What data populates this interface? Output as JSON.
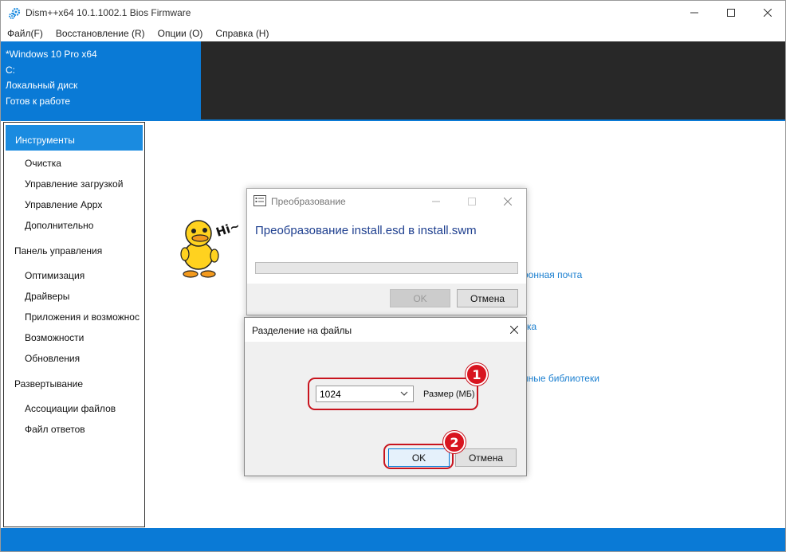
{
  "window": {
    "title": "Dism++x64 10.1.1002.1 Bios Firmware",
    "icon": "gears-icon"
  },
  "menu": [
    "Файл(F)",
    "Восстановление (R)",
    "Опции (O)",
    "Справка (H)"
  ],
  "header": {
    "lines": [
      "*Windows 10 Pro x64",
      "C:",
      "Локальный диск",
      "Готов к работе"
    ]
  },
  "sidebar": {
    "active": "Инструменты",
    "groups": [
      {
        "category": null,
        "items": [
          "Очистка",
          "Управление загрузкой",
          "Управление Appx",
          "Дополнительно"
        ]
      },
      {
        "category": "Панель управления",
        "items": [
          "Оптимизация",
          "Драйверы",
          "Приложения и возможнос",
          "Возможности",
          "Обновления"
        ]
      },
      {
        "category": "Развертывание",
        "items": [
          "Ассоциации файлов",
          "Файл ответов"
        ]
      }
    ]
  },
  "background_links": [
    "ронная почта",
    "ка",
    "нные библиотеки"
  ],
  "convert_dialog": {
    "title": "Преобразование",
    "heading": "Преобразование install.esd в install.swm",
    "progress": 0,
    "ok_label": "OK",
    "cancel_label": "Отмена"
  },
  "split_dialog": {
    "title": "Разделение на файлы",
    "size_value": "1024",
    "size_label": "Размер (МБ)",
    "ok_label": "OK",
    "cancel_label": "Отмена"
  },
  "callouts": [
    "1",
    "2"
  ],
  "colors": {
    "accent": "#0a7ad6",
    "header_dark": "#282828",
    "callout_red": "#c8141e",
    "link": "#1a7fd0"
  }
}
